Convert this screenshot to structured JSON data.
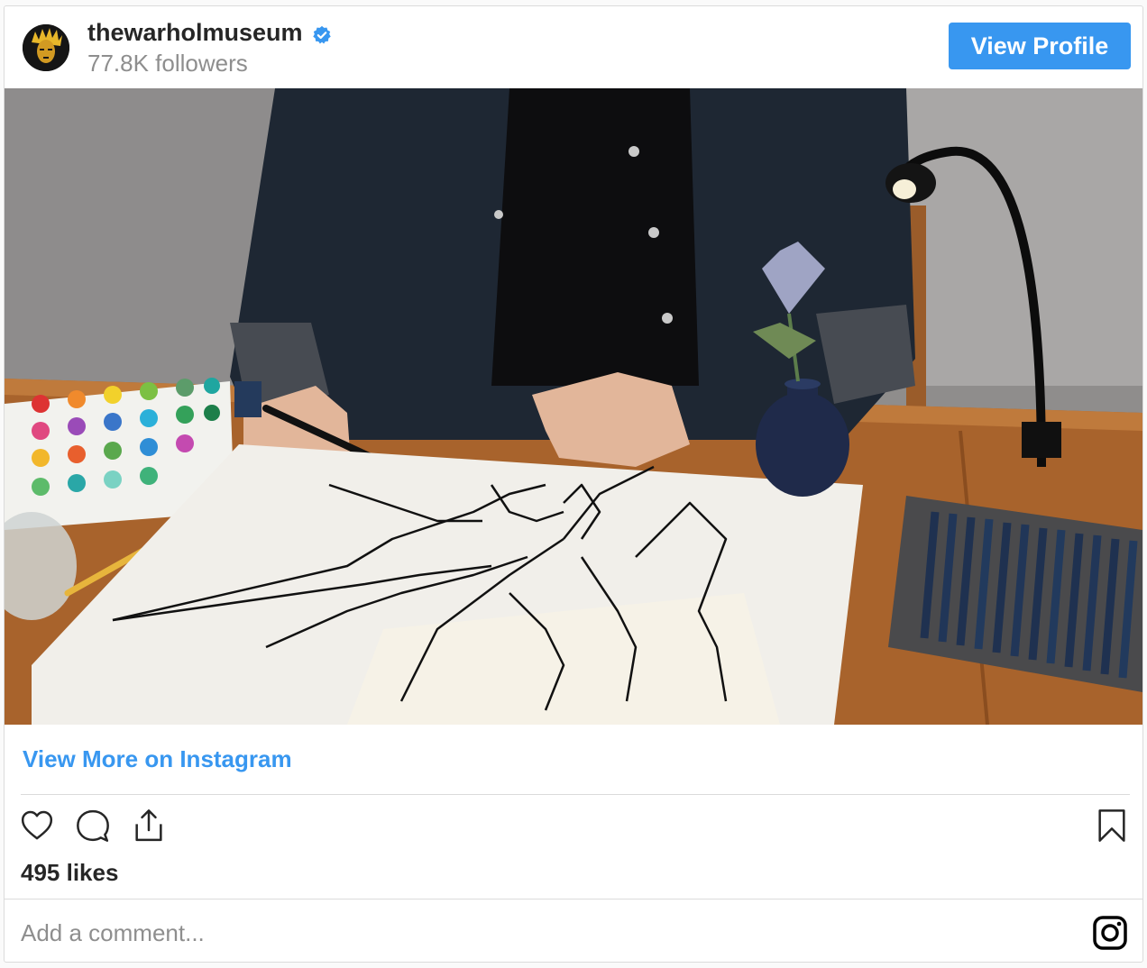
{
  "header": {
    "username": "thewarholmuseum",
    "followers": "77.8K followers",
    "view_profile_label": "View Profile",
    "verified_icon": "verified-badge-icon",
    "accent_color": "#3897f0"
  },
  "media": {
    "image_icon": "post-photo"
  },
  "links": {
    "view_more": "View More on Instagram"
  },
  "actions": {
    "icons": [
      "heart-icon",
      "comment-icon",
      "share-icon",
      "bookmark-icon"
    ]
  },
  "stats": {
    "likes": "495 likes"
  },
  "comment": {
    "placeholder": "Add a comment..."
  },
  "footer": {
    "icon": "instagram-icon"
  }
}
